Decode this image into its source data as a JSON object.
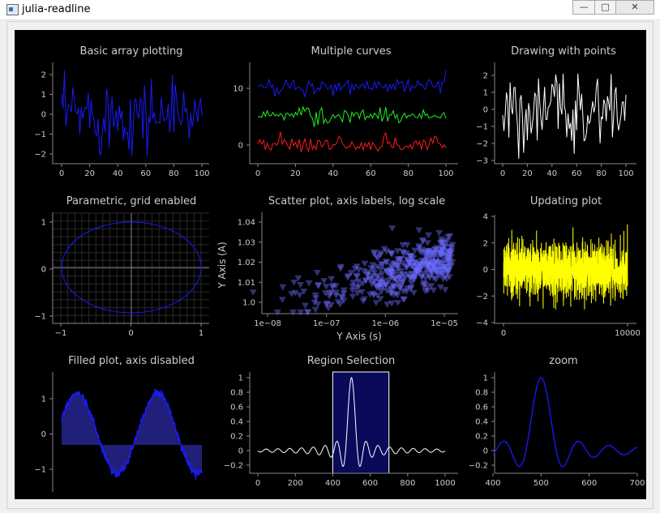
{
  "window": {
    "title": "julia-readline",
    "minimize_glyph": "—",
    "maximize_glyph": "□",
    "close_glyph": "✕"
  },
  "plots": {
    "p1": {
      "title": "Basic array plotting",
      "xticks": [
        "0",
        "20",
        "40",
        "60",
        "80",
        "100"
      ],
      "yticks": [
        "2",
        "1",
        "0",
        "−1",
        "−2"
      ]
    },
    "p2": {
      "title": "Multiple curves",
      "xticks": [
        "0",
        "20",
        "40",
        "60",
        "80",
        "100"
      ],
      "yticks": [
        "10",
        "0"
      ],
      "colors": [
        "#1a1aff",
        "#22ee22",
        "#ff1a1a"
      ]
    },
    "p3": {
      "title": "Drawing with points",
      "xticks": [
        "0",
        "20",
        "40",
        "60",
        "80",
        "100"
      ],
      "yticks": [
        "2",
        "1",
        "0",
        "−1",
        "−2",
        "−3"
      ]
    },
    "p4": {
      "title": "Parametric, grid enabled",
      "xticks": [
        "−1",
        "0",
        "1"
      ],
      "yticks": [
        "1",
        "0",
        "−1"
      ]
    },
    "p5": {
      "title": "Scatter plot, axis labels, log scale",
      "xlabel": "Y Axis (s)",
      "ylabel": "Y Axis (A)",
      "xticks": [
        "1e−08",
        "1e−07",
        "1e−06",
        "1e−05"
      ],
      "yticks": [
        "1.04",
        "1.03",
        "1.02",
        "1.01",
        "1.0"
      ],
      "color": "#6b6bff"
    },
    "p6": {
      "title": "Updating plot",
      "xticks": [
        "0",
        "10000"
      ],
      "yticks": [
        "4",
        "2",
        "0",
        "−2",
        "−4"
      ],
      "color": "#ffff00"
    },
    "p7": {
      "title": "Filled plot, axis disabled",
      "yticks": [
        "1",
        "0",
        "−1"
      ]
    },
    "p8": {
      "title": "Region Selection",
      "xticks": [
        "0",
        "200",
        "400",
        "600",
        "800",
        "1000"
      ],
      "yticks": [
        "1",
        "0.8",
        "0.6",
        "0.4",
        "0.2",
        "0",
        "−0.2"
      ],
      "selection": [
        400,
        700
      ]
    },
    "p9": {
      "title": "zoom",
      "xticks": [
        "400",
        "500",
        "600",
        "700"
      ],
      "yticks": [
        "1",
        "0.8",
        "0.6",
        "0.4",
        "0.2",
        "0",
        "−0.2"
      ]
    }
  }
}
